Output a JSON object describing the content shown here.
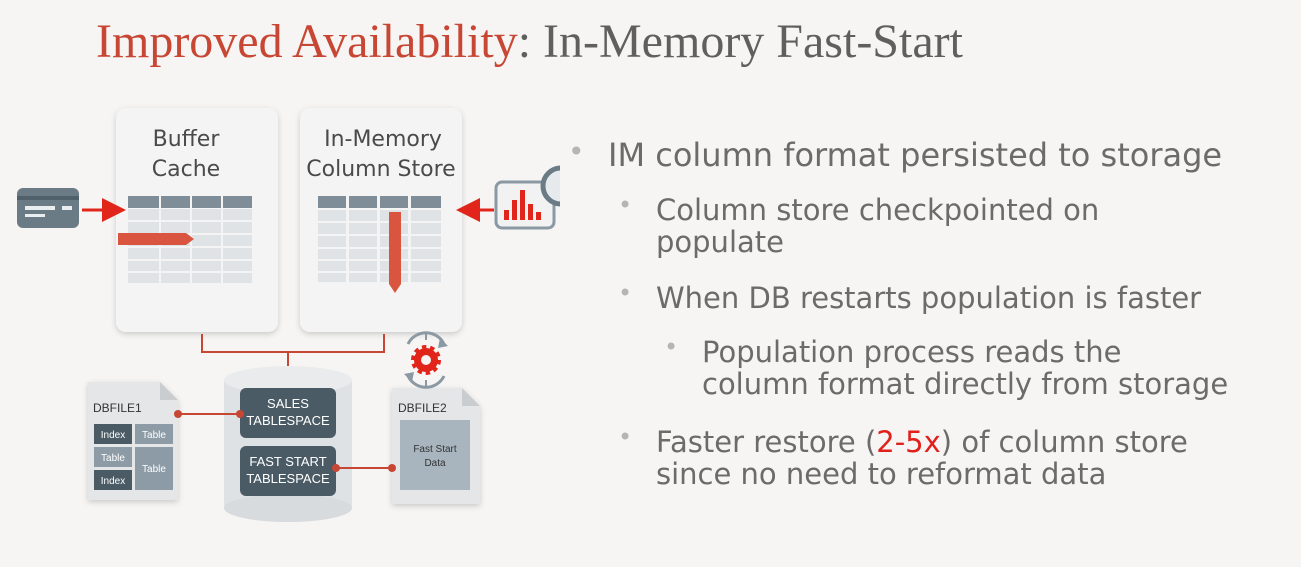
{
  "title": {
    "highlight": "Improved Availability",
    "rest": ": In-Memory Fast-Start"
  },
  "diagram": {
    "buffer_cache": [
      "Buffer",
      "Cache"
    ],
    "column_store": [
      "In-Memory",
      "Column Store"
    ],
    "dbfile1": {
      "label": "DBFILE1",
      "cells": [
        "Index",
        "Index",
        "Index",
        "Table",
        "Table",
        "Table"
      ]
    },
    "tablespaces": {
      "sales": [
        "SALES",
        "TABLESPACE"
      ],
      "fast_start": [
        "FAST START",
        "TABLESPACE"
      ]
    },
    "dbfile2": {
      "label": "DBFILE2",
      "data": [
        "Fast Start",
        "Data"
      ]
    },
    "icons": {
      "left": "credit-card-icon",
      "right": "analytics-magnifier-icon",
      "sync": "gear-sync-icon"
    },
    "colors": {
      "accent_red": "#c74634",
      "arrow_red": "#e1251b",
      "slate": "#4a5b66",
      "cylinder": "#dfe2e4"
    }
  },
  "bullets": {
    "b1": "IM column format persisted to storage",
    "b2_l1": "Column store checkpointed on",
    "b2_l2": "populate",
    "b3": "When DB restarts population is faster",
    "b4_l1": "Population process reads the",
    "b4_l2": "column format directly from storage",
    "b5_pre": "Faster restore (",
    "b5_hl": "2-5x",
    "b5_post": ") of column store",
    "b5_l2": "since no need to reformat data"
  }
}
